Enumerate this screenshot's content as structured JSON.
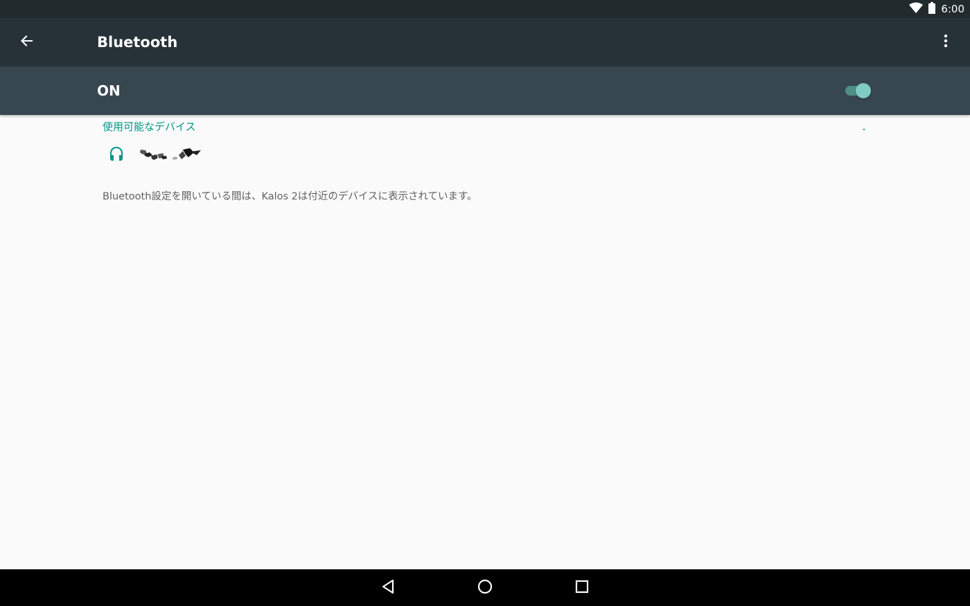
{
  "status_bar": {
    "time": "6:00",
    "icons": [
      "wifi-icon",
      "battery-icon"
    ]
  },
  "app_bar": {
    "title": "Bluetooth",
    "back_icon": "arrow-left-icon",
    "menu_icon": "more-vert-icon"
  },
  "switch_bar": {
    "label": "ON",
    "checked": true
  },
  "available_devices": {
    "header": "使用可能なデバイス",
    "items": [
      {
        "icon": "headphones-icon",
        "name": ""
      }
    ]
  },
  "footer": {
    "text": "Bluetooth設定を開いている間は、Kalos 2は付近のデバイスに表示されています。"
  },
  "nav_bar": {
    "buttons": [
      "back-triangle-icon",
      "home-circle-icon",
      "recents-square-icon"
    ]
  },
  "colors": {
    "status_bar": "#222a2e",
    "app_bar": "#263238",
    "switch_bar": "#37474f",
    "accent": "#009688",
    "toggle_thumb": "#80cbc4",
    "background": "#fafafa"
  }
}
